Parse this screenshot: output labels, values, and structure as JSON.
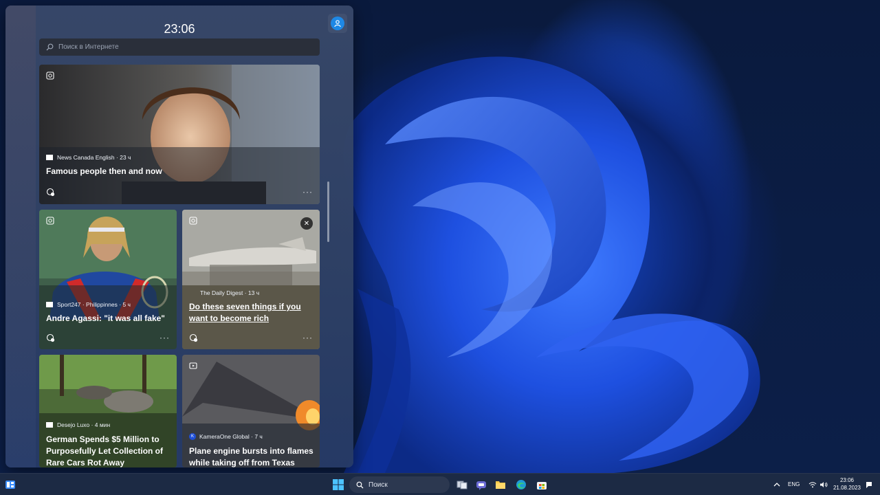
{
  "widgets": {
    "clock": "23:06",
    "search": {
      "placeholder": "Поиск в Интернете"
    },
    "cards": [
      {
        "source": "News Canada English · 23 ч",
        "headline": "Famous people then and now"
      },
      {
        "source": "Sport247 · Philippinnes · 5 ч",
        "headline": "Andre Agassi: \"it was all fake\""
      },
      {
        "source": "The Daily Digest · 13 ч",
        "headline_line1": "Do these seven things if you",
        "headline_line2": "want to become rich"
      },
      {
        "source": "Desejo Luxo · 4 мин",
        "headline_line1": "German Spends $5 Million to",
        "headline_line2": "Purposefully Let Collection of",
        "headline_line3": "Rare Cars Rot Away"
      },
      {
        "source": "KameraOne Global · 7 ч",
        "source_logo_letter": "K",
        "headline_line1": "Plane engine bursts into flames",
        "headline_line2": "while taking off from Texas"
      }
    ],
    "more_label": "···",
    "close_label": "✕"
  },
  "taskbar": {
    "search_label": "Поиск",
    "language": "ENG",
    "time": "23:06",
    "date": "21.08.2023",
    "icons": [
      "widgets-icon",
      "start-icon",
      "search-icon",
      "task-view-icon",
      "teams-chat-icon",
      "file-explorer-icon",
      "edge-icon",
      "store-icon",
      "chevron-up-icon",
      "wifi-icon",
      "volume-icon",
      "notification-icon"
    ]
  },
  "colors": {
    "accent": "#1e88e5",
    "taskbar": "#1c2a44",
    "wallpaper": "#1a4de8"
  }
}
